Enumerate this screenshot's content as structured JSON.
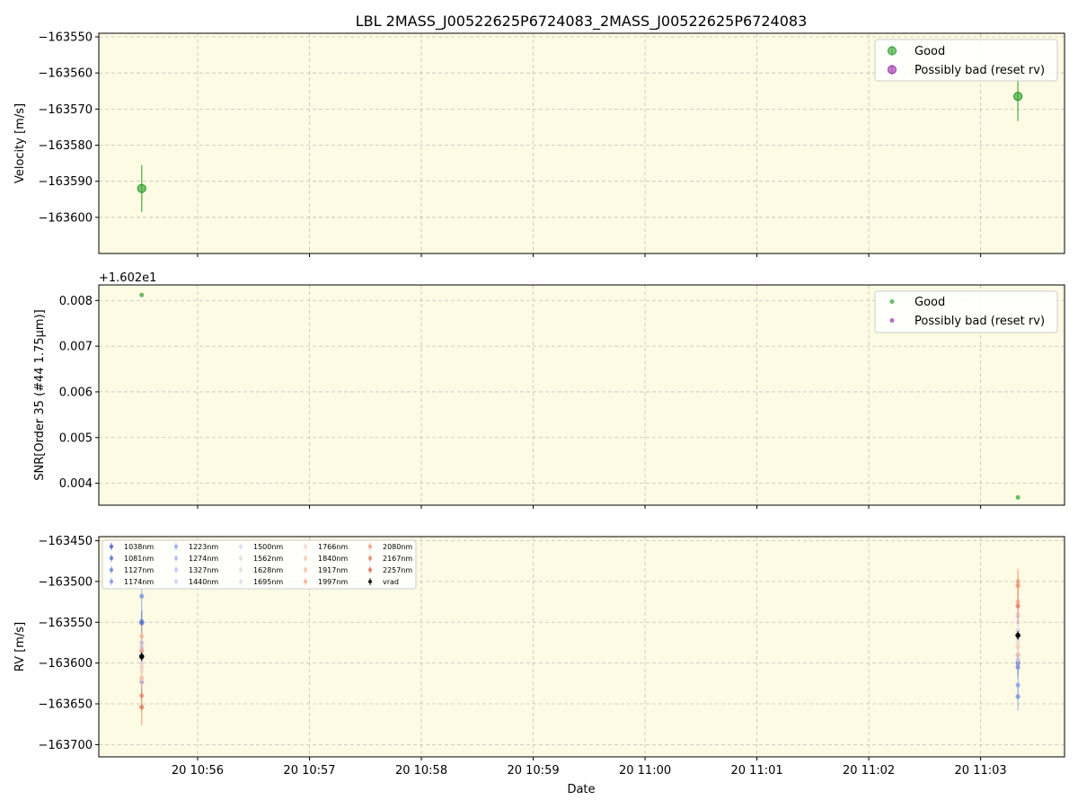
{
  "figure": {
    "title": "LBL 2MASS_J00522625P6724083_2MASS_J00522625P6724083",
    "xlabel": "Date",
    "x_ticks": [
      "20 10:56",
      "20 10:57",
      "20 10:58",
      "20 10:59",
      "20 11:00",
      "20 11:01",
      "20 11:02",
      "20 11:03"
    ]
  },
  "colors": {
    "good": "#2ca02c",
    "bad": "#9b30a8",
    "background": "#fdfbe3",
    "vrad": "#000000"
  },
  "chart_data": [
    {
      "type": "scatter",
      "panel": "velocity",
      "ylabel": "Velocity [m/s]",
      "xlim": [
        "10:55:07",
        "11:03:45"
      ],
      "ylim": [
        -163610,
        -163549
      ],
      "y_ticks": [
        -163550,
        -163560,
        -163570,
        -163580,
        -163590,
        -163600
      ],
      "y_tick_labels": [
        "−163550",
        "−163560",
        "−163570",
        "−163580",
        "−163590",
        "−163600"
      ],
      "legend": {
        "position": "top-right",
        "entries": [
          "Good",
          "Possibly bad (reset rv)"
        ]
      },
      "series": [
        {
          "name": "Good",
          "points": [
            {
              "x": "10:55:30",
              "y": -163592,
              "err": 6.5
            },
            {
              "x": "11:03:20",
              "y": -163566.5,
              "err": 6.8
            }
          ]
        },
        {
          "name": "Possibly bad (reset rv)",
          "points": []
        }
      ]
    },
    {
      "type": "scatter",
      "panel": "snr",
      "ylabel": "SNR[Order 35 (#44 1.75μm)]",
      "offset_label": "+1.602e1",
      "xlim": [
        "10:55:07",
        "11:03:45"
      ],
      "ylim": [
        0.00352,
        0.00834
      ],
      "y_ticks": [
        0.004,
        0.005,
        0.006,
        0.007,
        0.008
      ],
      "y_tick_labels": [
        "0.004",
        "0.005",
        "0.006",
        "0.007",
        "0.008"
      ],
      "legend": {
        "position": "top-right",
        "entries": [
          "Good",
          "Possibly bad (reset rv)"
        ]
      },
      "series": [
        {
          "name": "Good",
          "points": [
            {
              "x": "10:55:30",
              "y": 0.00812
            },
            {
              "x": "11:03:20",
              "y": 0.00369
            }
          ]
        },
        {
          "name": "Possibly bad (reset rv)",
          "points": []
        }
      ]
    },
    {
      "type": "scatter",
      "panel": "rv",
      "ylabel": "RV [m/s]",
      "xlim": [
        "10:55:07",
        "11:03:45"
      ],
      "ylim": [
        -163715,
        -163445
      ],
      "y_ticks": [
        -163450,
        -163500,
        -163550,
        -163600,
        -163650,
        -163700
      ],
      "y_tick_labels": [
        "−163450",
        "−163500",
        "−163550",
        "−163600",
        "−163650",
        "−163700"
      ],
      "legend": {
        "position": "top-left",
        "columns": 5
      },
      "series": [
        {
          "name": "1038nm",
          "color": "#4a5fc7",
          "values": [
            -163551,
            -163600
          ]
        },
        {
          "name": "1081nm",
          "color": "#5671d6",
          "values": [
            -163549,
            -163605
          ]
        },
        {
          "name": "1127nm",
          "color": "#6a84e2",
          "values": [
            -163518,
            -163641
          ]
        },
        {
          "name": "1174nm",
          "color": "#7e96ec",
          "values": [
            -163623,
            -163627
          ]
        },
        {
          "name": "1223nm",
          "color": "#92a9f2",
          "values": [
            -163581,
            -163590
          ]
        },
        {
          "name": "1274nm",
          "color": "#a6baf5",
          "values": [
            -163575,
            -163596
          ]
        },
        {
          "name": "1327nm",
          "color": "#b8c8f5",
          "values": [
            -163590,
            -163542
          ]
        },
        {
          "name": "1440nm",
          "color": "#c9d5f3",
          "values": [
            -163585,
            -163570
          ]
        },
        {
          "name": "1500nm",
          "color": "#d5dcf0",
          "values": [
            -163600,
            -163560
          ]
        },
        {
          "name": "1562nm",
          "color": "#dddfe9",
          "values": [
            -163595,
            -163550
          ]
        },
        {
          "name": "1628nm",
          "color": "#e3dcdc",
          "values": [
            -163610,
            -163575
          ]
        },
        {
          "name": "1695nm",
          "color": "#e0dde8",
          "values": [
            -163580,
            -163560
          ]
        },
        {
          "name": "1766nm",
          "color": "#f2d6cc",
          "values": [
            -163620,
            -163540
          ]
        },
        {
          "name": "1840nm",
          "color": "#f5cbb9",
          "values": [
            -163605,
            -163580
          ]
        },
        {
          "name": "1917nm",
          "color": "#f6bda7",
          "values": [
            -163618,
            -163590
          ]
        },
        {
          "name": "1997nm",
          "color": "#f4ad93",
          "values": [
            -163567,
            -163525
          ]
        },
        {
          "name": "2080nm",
          "color": "#f09c80",
          "values": [
            -163585,
            -163500
          ]
        },
        {
          "name": "2167nm",
          "color": "#e8856a",
          "values": [
            -163640,
            -163505
          ]
        },
        {
          "name": "2257nm",
          "color": "#de6e58",
          "values": [
            -163654,
            -163530
          ]
        },
        {
          "name": "vrad",
          "color": "#000000",
          "values": [
            -163592,
            -163566
          ]
        }
      ],
      "x": [
        "10:55:30",
        "11:03:20"
      ]
    }
  ]
}
